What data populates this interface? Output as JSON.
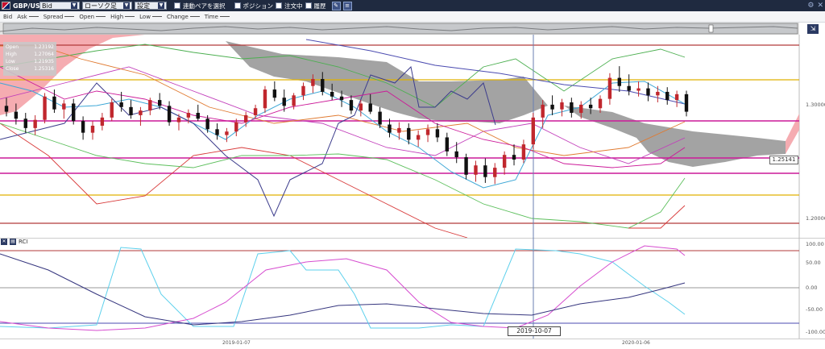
{
  "toolbar": {
    "symbol": "GBP/USD",
    "price_type": "Bid",
    "chart_type": "ローソク足",
    "setting": "設定",
    "linked_pairs_label": "連動ペアを選択",
    "position_label": "ポジション",
    "orders_label": "注文中",
    "history_label": "履歴"
  },
  "legend": {
    "items": [
      "Bid",
      "Ask",
      "Spread",
      "Open",
      "High",
      "Low",
      "Change",
      "Time"
    ]
  },
  "ohlc": {
    "open_label": "Open",
    "open": "1.23192",
    "high_label": "High",
    "high": "1.27064",
    "low_label": "Low",
    "low": "1.21935",
    "close_label": "Close",
    "close": "1.25316"
  },
  "price_axis": {
    "label_upper": "1.30000",
    "label_lower": "1.20000",
    "current": "1.25141"
  },
  "rci": {
    "title": "RCI",
    "ticks": [
      "100.00",
      "50.00",
      "0.00",
      "-50.00",
      "-100.00"
    ]
  },
  "crosshair_date": "2019-10-07",
  "x_axis": {
    "labels": [
      "2019-01-07",
      "2020-01-06"
    ]
  },
  "colors": {
    "bull": "#c0272d",
    "bear": "#111111",
    "kumo_bear": "#999999",
    "kumo_bull": "#f4a3a8",
    "hline_magenta": "#cc1a99",
    "hline_gold": "#e0b100",
    "hline_brown": "#b23a3a"
  },
  "chart_data": {
    "type": "candlestick",
    "series": [
      {
        "name": "GBP/USD",
        "values": [
          [
            1.291,
            1.298,
            1.282,
            1.286
          ],
          [
            1.286,
            1.293,
            1.275,
            1.28
          ],
          [
            1.28,
            1.285,
            1.268,
            1.272
          ],
          [
            1.272,
            1.283,
            1.266,
            1.279
          ],
          [
            1.279,
            1.302,
            1.276,
            1.299
          ],
          [
            1.299,
            1.305,
            1.285,
            1.288
          ],
          [
            1.288,
            1.296,
            1.28,
            1.293
          ],
          [
            1.293,
            1.297,
            1.275,
            1.278
          ],
          [
            1.278,
            1.282,
            1.262,
            1.268
          ],
          [
            1.268,
            1.278,
            1.262,
            1.274
          ],
          [
            1.274,
            1.285,
            1.27,
            1.281
          ],
          [
            1.281,
            1.297,
            1.278,
            1.294
          ],
          [
            1.294,
            1.303,
            1.286,
            1.29
          ],
          [
            1.29,
            1.296,
            1.28,
            1.283
          ],
          [
            1.283,
            1.29,
            1.274,
            1.287
          ],
          [
            1.287,
            1.298,
            1.283,
            1.296
          ],
          [
            1.296,
            1.302,
            1.288,
            1.291
          ],
          [
            1.291,
            1.295,
            1.274,
            1.277
          ],
          [
            1.277,
            1.284,
            1.27,
            1.281
          ],
          [
            1.281,
            1.288,
            1.276,
            1.285
          ],
          [
            1.285,
            1.292,
            1.278,
            1.28
          ],
          [
            1.28,
            1.283,
            1.268,
            1.271
          ],
          [
            1.271,
            1.276,
            1.262,
            1.266
          ],
          [
            1.266,
            1.272,
            1.26,
            1.269
          ],
          [
            1.269,
            1.28,
            1.265,
            1.277
          ],
          [
            1.277,
            1.286,
            1.273,
            1.283
          ],
          [
            1.283,
            1.292,
            1.28,
            1.289
          ],
          [
            1.289,
            1.308,
            1.285,
            1.305
          ],
          [
            1.305,
            1.312,
            1.295,
            1.298
          ],
          [
            1.298,
            1.305,
            1.286,
            1.291
          ],
          [
            1.291,
            1.302,
            1.288,
            1.3
          ],
          [
            1.3,
            1.311,
            1.296,
            1.308
          ],
          [
            1.308,
            1.318,
            1.302,
            1.314
          ],
          [
            1.314,
            1.32,
            1.3,
            1.303
          ],
          [
            1.303,
            1.31,
            1.296,
            1.299
          ],
          [
            1.299,
            1.304,
            1.29,
            1.296
          ],
          [
            1.296,
            1.3,
            1.284,
            1.287
          ],
          [
            1.287,
            1.296,
            1.282,
            1.293
          ],
          [
            1.293,
            1.301,
            1.284,
            1.286
          ],
          [
            1.286,
            1.29,
            1.272,
            1.275
          ],
          [
            1.275,
            1.28,
            1.264,
            1.268
          ],
          [
            1.268,
            1.277,
            1.262,
            1.272
          ],
          [
            1.272,
            1.276,
            1.258,
            1.262
          ],
          [
            1.262,
            1.27,
            1.256,
            1.266
          ],
          [
            1.266,
            1.275,
            1.26,
            1.271
          ],
          [
            1.271,
            1.276,
            1.26,
            1.264
          ],
          [
            1.264,
            1.268,
            1.248,
            1.252
          ],
          [
            1.252,
            1.26,
            1.242,
            1.247
          ],
          [
            1.247,
            1.25,
            1.228,
            1.232
          ],
          [
            1.232,
            1.244,
            1.226,
            1.24
          ],
          [
            1.24,
            1.246,
            1.225,
            1.23
          ],
          [
            1.23,
            1.242,
            1.224,
            1.238
          ],
          [
            1.238,
            1.252,
            1.232,
            1.249
          ],
          [
            1.249,
            1.258,
            1.24,
            1.245
          ],
          [
            1.245,
            1.262,
            1.242,
            1.258
          ],
          [
            1.258,
            1.285,
            1.254,
            1.281
          ],
          [
            1.281,
            1.296,
            1.272,
            1.292
          ],
          [
            1.292,
            1.3,
            1.283,
            1.288
          ],
          [
            1.288,
            1.297,
            1.282,
            1.294
          ],
          [
            1.294,
            1.298,
            1.281,
            1.285
          ],
          [
            1.285,
            1.295,
            1.28,
            1.292
          ],
          [
            1.292,
            1.298,
            1.284,
            1.289
          ],
          [
            1.289,
            1.3,
            1.285,
            1.297
          ],
          [
            1.297,
            1.319,
            1.292,
            1.315
          ],
          [
            1.315,
            1.325,
            1.303,
            1.308
          ],
          [
            1.308,
            1.318,
            1.3,
            1.304
          ],
          [
            1.304,
            1.312,
            1.299,
            1.306
          ],
          [
            1.306,
            1.311,
            1.295,
            1.3
          ],
          [
            1.3,
            1.308,
            1.294,
            1.303
          ],
          [
            1.303,
            1.307,
            1.292,
            1.296
          ],
          [
            1.296,
            1.304,
            1.29,
            1.301
          ],
          [
            1.301,
            1.304,
            1.282,
            1.286
          ]
        ]
      }
    ],
    "xlabel": "",
    "ylabel": "",
    "ylim": [
      1.178,
      1.352
    ]
  }
}
